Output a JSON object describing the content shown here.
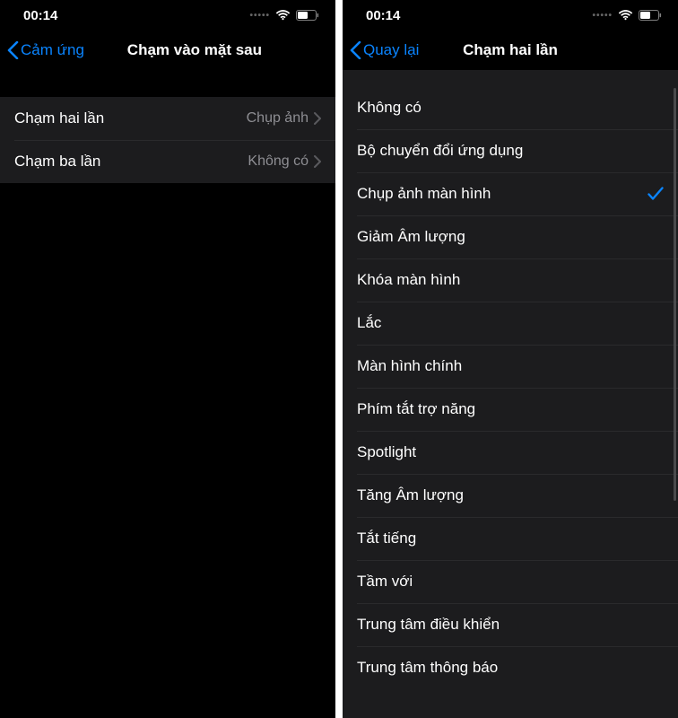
{
  "status": {
    "time": "00:14"
  },
  "left": {
    "back_label": "Cảm ứng",
    "title": "Chạm vào mặt sau",
    "rows": [
      {
        "label": "Chạm hai lần",
        "value": "Chụp ảnh"
      },
      {
        "label": "Chạm ba lần",
        "value": "Không có"
      }
    ]
  },
  "right": {
    "back_label": "Quay lại",
    "title": "Chạm hai lần",
    "options": [
      {
        "label": "Không có",
        "checked": false
      },
      {
        "label": "Bộ chuyển đổi ứng dụng",
        "checked": false
      },
      {
        "label": "Chụp ảnh màn hình",
        "checked": true
      },
      {
        "label": "Giảm Âm lượng",
        "checked": false
      },
      {
        "label": "Khóa màn hình",
        "checked": false
      },
      {
        "label": "Lắc",
        "checked": false
      },
      {
        "label": "Màn hình chính",
        "checked": false
      },
      {
        "label": "Phím tắt trợ năng",
        "checked": false
      },
      {
        "label": "Spotlight",
        "checked": false
      },
      {
        "label": "Tăng Âm lượng",
        "checked": false
      },
      {
        "label": "Tắt tiếng",
        "checked": false
      },
      {
        "label": "Tầm với",
        "checked": false
      },
      {
        "label": "Trung tâm điều khiển",
        "checked": false
      },
      {
        "label": "Trung tâm thông báo",
        "checked": false
      }
    ]
  }
}
